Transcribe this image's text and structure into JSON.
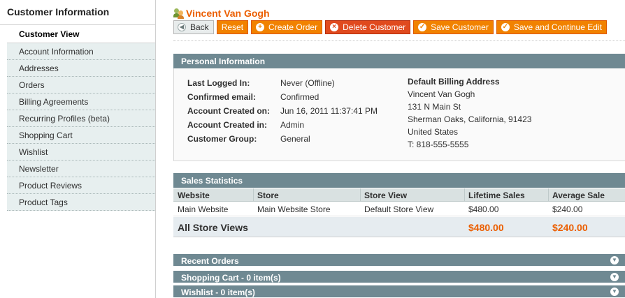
{
  "sidebar": {
    "title": "Customer Information",
    "active_tab": "Customer View",
    "items": [
      {
        "label": "Account Information"
      },
      {
        "label": "Addresses"
      },
      {
        "label": "Orders"
      },
      {
        "label": "Billing Agreements"
      },
      {
        "label": "Recurring Profiles (beta)"
      },
      {
        "label": "Shopping Cart"
      },
      {
        "label": "Wishlist"
      },
      {
        "label": "Newsletter"
      },
      {
        "label": "Product Reviews"
      },
      {
        "label": "Product Tags"
      }
    ]
  },
  "header": {
    "title": "Vincent Van Gogh",
    "icon": "customer-icon"
  },
  "toolbar": {
    "back_label": "Back",
    "reset_label": "Reset",
    "create_order_label": "Create Order",
    "delete_label": "Delete Customer",
    "save_label": "Save Customer",
    "save_continue_label": "Save and Continue Edit"
  },
  "personal": {
    "heading": "Personal Information",
    "fields": [
      {
        "label": "Last Logged In:",
        "value": "Never (Offline)"
      },
      {
        "label": "Confirmed email:",
        "value": "Confirmed"
      },
      {
        "label": "Account Created on:",
        "value": "Jun 16, 2011 11:37:41 PM"
      },
      {
        "label": "Account Created in:",
        "value": "Admin"
      },
      {
        "label": "Customer Group:",
        "value": "General"
      }
    ],
    "billing": {
      "title": "Default Billing Address",
      "lines": [
        "Vincent Van Gogh",
        "131 N Main St",
        "Sherman Oaks, California, 91423",
        "United States",
        "T: 818-555-5555"
      ]
    }
  },
  "sales": {
    "heading": "Sales Statistics",
    "columns": [
      "Website",
      "Store",
      "Store View",
      "Lifetime Sales",
      "Average Sale"
    ],
    "rows": [
      [
        "Main Website",
        "Main Website Store",
        "Default Store View",
        "$480.00",
        "$240.00"
      ]
    ],
    "total": {
      "label": "All Store Views",
      "lifetime": "$480.00",
      "average": "$240.00"
    }
  },
  "collapsibles": [
    {
      "label": "Recent Orders"
    },
    {
      "label": "Shopping Cart - 0 item(s)"
    },
    {
      "label": "Wishlist - 0 item(s)"
    }
  ],
  "colors": {
    "accent": "#eb5e00",
    "button": "#f18200",
    "section_header": "#6f8992",
    "sidebar_tab_bg": "#e7efef"
  }
}
